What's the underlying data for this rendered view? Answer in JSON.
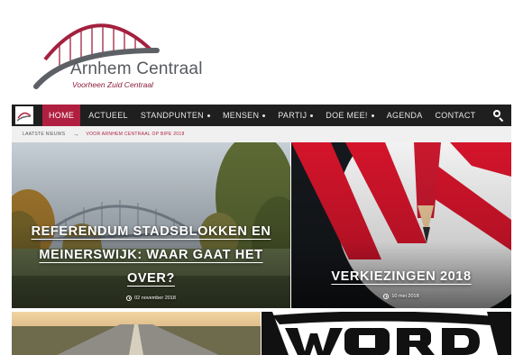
{
  "brand": {
    "name": "Arnhem Centraal",
    "tagline": "Voorheen Zuid Centraal",
    "accent": "#b01f3f",
    "text_gray": "#555a5f"
  },
  "nav": {
    "items": [
      {
        "label": "HOME",
        "active": true,
        "dropdown": false
      },
      {
        "label": "ACTUEEL",
        "active": false,
        "dropdown": false
      },
      {
        "label": "STANDPUNTEN",
        "active": false,
        "dropdown": true
      },
      {
        "label": "MENSEN",
        "active": false,
        "dropdown": true
      },
      {
        "label": "PARTIJ",
        "active": false,
        "dropdown": true
      },
      {
        "label": "DOE MEE!",
        "active": false,
        "dropdown": true
      },
      {
        "label": "AGENDA",
        "active": false,
        "dropdown": false
      },
      {
        "label": "CONTACT",
        "active": false,
        "dropdown": false
      }
    ],
    "search_icon": "search-icon"
  },
  "ticker": {
    "label": "LAATSTE NIEUWS",
    "arrow": "→",
    "text": "VOOR ARNHEM CENTRAAL OP BIPE 2018"
  },
  "featured": [
    {
      "title": "REFERENDUM STADSBLOKKEN EN MEINERSWIJK: WAAR GAAT HET OVER?",
      "date": "02 november 2018"
    },
    {
      "title": "VERKIEZINGEN 2018",
      "date": "10 mei 2018"
    },
    {
      "title": "",
      "date": ""
    },
    {
      "title": "",
      "date": ""
    }
  ]
}
